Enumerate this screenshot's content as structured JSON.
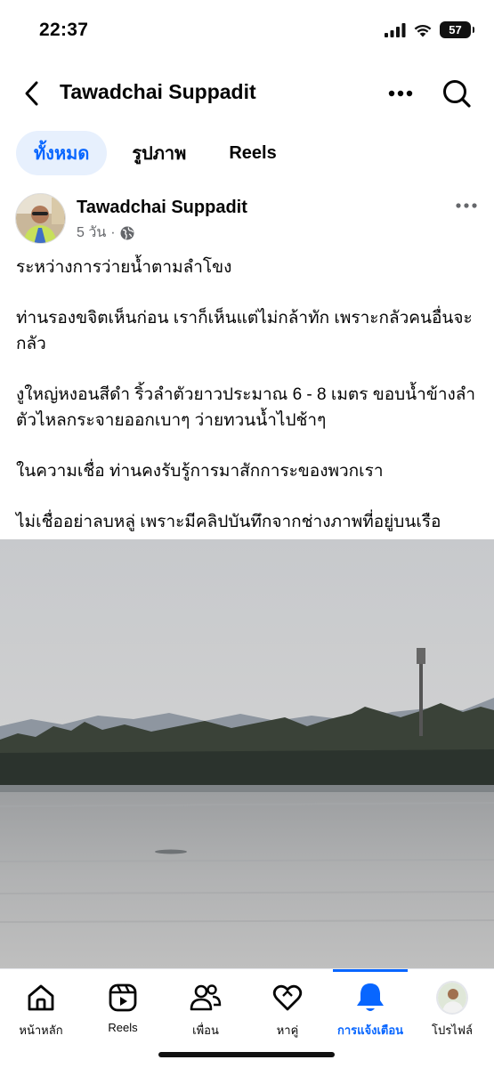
{
  "status_bar": {
    "time": "22:37",
    "battery": "57"
  },
  "header": {
    "title": "Tawadchai Suppadit"
  },
  "tabs": [
    {
      "label": "ทั้งหมด",
      "active": true
    },
    {
      "label": "รูปภาพ",
      "active": false
    },
    {
      "label": "Reels",
      "active": false
    }
  ],
  "post": {
    "author": "Tawadchai Suppadit",
    "time": "5 วัน",
    "separator": "·",
    "privacy_icon": "globe-icon",
    "paragraphs": [
      "ระหว่างการว่ายน้ำตามลำโขง",
      "ท่านรองขจิตเห็นก่อน เราก็เห็นแต่ไม่กล้าทัก เพราะกลัวคนอื่นจะกลัว",
      "งูใหญ่หงอนสีดำ ริ้วลำตัวยาวประมาณ 6 - 8 เมตร ขอบน้ำข้างลำตัวไหลกระจายออกเบาๆ ว่ายทวนน้ำไปช้าๆ",
      "ในความเชื่อ ท่านคงรับรู้การมาสักการะของพวกเรา",
      "ไม่เชื่ออย่าลบหลู่ เพราะมีคลิปบันทึกจากช่างภาพที่อยู่บนเรือ"
    ]
  },
  "bottom_nav": [
    {
      "label": "หน้าหลัก",
      "icon": "home-icon",
      "active": false
    },
    {
      "label": "Reels",
      "icon": "reels-icon",
      "active": false
    },
    {
      "label": "เพื่อน",
      "icon": "friends-icon",
      "active": false
    },
    {
      "label": "หาคู่",
      "icon": "dating-heart-icon",
      "active": false
    },
    {
      "label": "การแจ้งเตือน",
      "icon": "bell-icon",
      "active": true
    },
    {
      "label": "โปรไฟล์",
      "icon": "profile-avatar",
      "active": false
    }
  ],
  "colors": {
    "accent": "#0866ff",
    "tab_active_bg": "#e7f0fd",
    "meta_text": "#65676b"
  }
}
